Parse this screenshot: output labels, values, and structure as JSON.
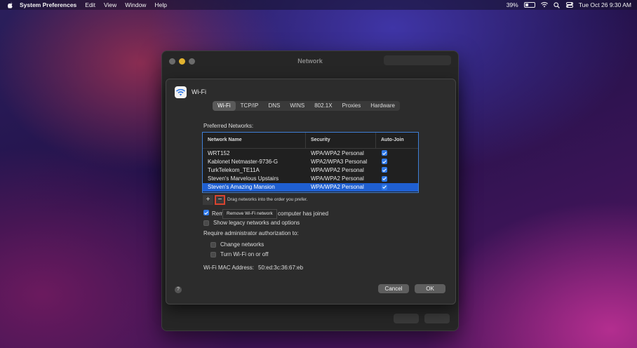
{
  "menubar": {
    "app_name": "System Preferences",
    "items": [
      "Edit",
      "View",
      "Window",
      "Help"
    ],
    "battery_percent": "39%",
    "battery_level": 0.39,
    "datetime": "Tue Oct 26  9:30 AM"
  },
  "outer_window": {
    "title": "Network"
  },
  "sheet": {
    "title": "Wi-Fi",
    "tabs": [
      "Wi-Fi",
      "TCP/IP",
      "DNS",
      "WINS",
      "802.1X",
      "Proxies",
      "Hardware"
    ],
    "active_tab": "Wi-Fi",
    "preferred_label": "Preferred Networks:",
    "columns": [
      "Network Name",
      "Security",
      "Auto-Join"
    ],
    "networks": [
      {
        "name": "WRT152",
        "security": "WPA/WPA2 Personal",
        "auto_join": true
      },
      {
        "name": "Kablonet Netmaster-9736-G",
        "security": "WPA2/WPA3 Personal",
        "auto_join": true
      },
      {
        "name": "TurkTelekom_TE11A",
        "security": "WPA/WPA2 Personal",
        "auto_join": true
      },
      {
        "name": "Steven's Marvelous Upstairs",
        "security": "WPA/WPA2 Personal",
        "auto_join": true
      },
      {
        "name": "Steven's Amazing Mansion",
        "security": "WPA/WPA2 Personal",
        "auto_join": true,
        "selected": true
      }
    ],
    "add_label": "+",
    "remove_label": "−",
    "drag_hint": "Drag networks into the order you prefer.",
    "tooltip": "Remove Wi-Fi network",
    "remember_prefix": "Rem",
    "remember_suffix": "computer has joined",
    "legacy_label": "Show legacy networks and options",
    "admin_label": "Require administrator authorization to:",
    "change_networks_label": "Change networks",
    "turn_wifi_label": "Turn Wi-Fi on or off",
    "mac_label": "Wi-Fi MAC Address:",
    "mac_value": "50:ed:3c:36:67:eb",
    "help_label": "?",
    "cancel_label": "Cancel",
    "ok_label": "OK"
  },
  "colors": {
    "accent": "#2f79e8",
    "selection": "#1f5fd1",
    "highlight_box": "#d8432f"
  }
}
